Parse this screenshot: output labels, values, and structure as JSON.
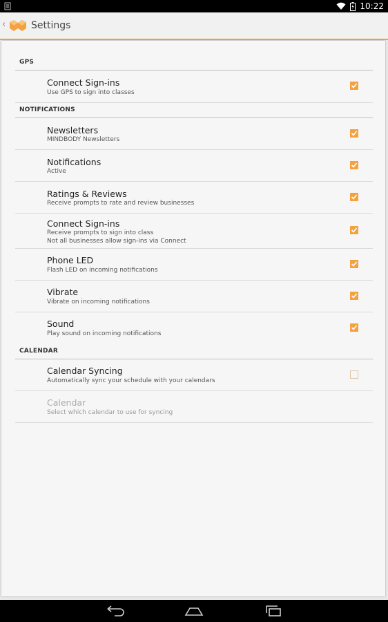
{
  "status": {
    "time": "10:22"
  },
  "header": {
    "title": "Settings"
  },
  "sections": {
    "gps": {
      "label": "GPS",
      "rows": [
        {
          "title": "Connect Sign-ins",
          "subtitle": "Use GPS to sign into classes",
          "checked": true
        }
      ]
    },
    "notifications": {
      "label": "NOTIFICATIONS",
      "rows": [
        {
          "title": "Newsletters",
          "subtitle": "MINDBODY Newsletters",
          "checked": true
        },
        {
          "title": "Notifications",
          "subtitle": "Active",
          "checked": true
        },
        {
          "title": "Ratings & Reviews",
          "subtitle": "Receive prompts to rate and review businesses",
          "checked": true
        },
        {
          "title": "Connect Sign-ins",
          "subtitle": "Receive prompts to sign into class",
          "subtitle2": "Not all businesses allow sign-ins via Connect",
          "checked": true
        },
        {
          "title": "Phone LED",
          "subtitle": "Flash LED on incoming notifications",
          "checked": true
        },
        {
          "title": "Vibrate",
          "subtitle": "Vibrate on incoming notifications",
          "checked": true
        },
        {
          "title": "Sound",
          "subtitle": "Play sound on incoming notifications",
          "checked": true
        }
      ]
    },
    "calendar": {
      "label": "CALENDAR",
      "rows": [
        {
          "title": "Calendar Syncing",
          "subtitle": "Automatically sync your schedule with your calendars",
          "checked": false
        },
        {
          "title": "Calendar",
          "subtitle": "Select which calendar to use for syncing",
          "disabled": true
        }
      ]
    }
  },
  "colors": {
    "accent": "#f3a23f",
    "background": "#e8e8e8"
  }
}
